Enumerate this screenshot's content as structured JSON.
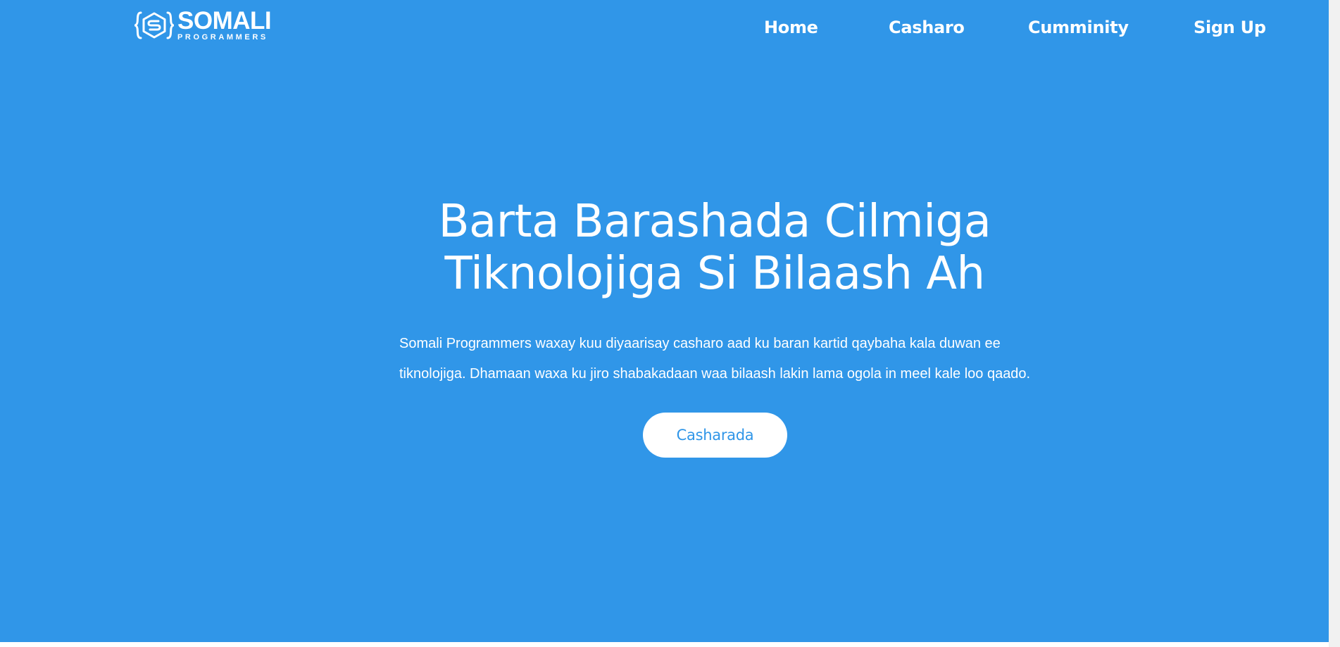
{
  "brand": {
    "name": "SOMALI",
    "tagline": "PROGRAMMERS",
    "logo_icon": "hexagon-s-braces-icon"
  },
  "nav": {
    "items": [
      {
        "label": "Home"
      },
      {
        "label": "Casharo"
      },
      {
        "label": "Cumminity"
      },
      {
        "label": "Sign Up"
      }
    ]
  },
  "hero": {
    "title_line1": "Barta Barashada Cilmiga",
    "title_line2": "Tiknolojiga Si Bilaash Ah",
    "description": "Somali Programmers waxay kuu diyaarisay casharo aad ku baran kartid qaybaha kala duwan ee tiknolojiga. Dhamaan waxa ku jiro shabakadaan waa bilaash lakin lama ogola in meel kale loo qaado.",
    "cta_label": "Casharada"
  },
  "colors": {
    "background": "#3096e8",
    "text": "#ffffff",
    "button_bg": "#ffffff",
    "button_text": "#3096e8"
  }
}
